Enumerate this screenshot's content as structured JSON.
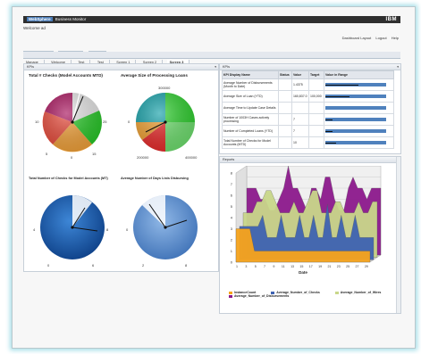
{
  "app": {
    "brand": "WebSphere",
    "product": "Business Monitor",
    "vendor": "IBM"
  },
  "welcome": "Welcome ad",
  "toplinks": {
    "dashboard_layout": "Dashboard Layout",
    "logout": "Logout",
    "help": "Help"
  },
  "top_tabs": [
    "Getting Started",
    "Dashboards",
    "Utilities"
  ],
  "nav_tabs": [
    "Manage",
    "Welcome",
    "Test",
    "Test",
    "Screen 1",
    "Screen 2",
    "Screen 3"
  ],
  "nav_selected": 6,
  "left_panel": {
    "title": "KPIs",
    "gauges": [
      {
        "title": "Total # Checks (Model Accounts MTD)",
        "labels": [
          "0",
          "5",
          "10",
          "15",
          "20",
          "25",
          "30"
        ]
      },
      {
        "title": "Average Size of Processing Loans",
        "labels": [
          "0",
          "100000",
          "200000",
          "300000",
          "400000"
        ]
      },
      {
        "title": "Total Number of Checks for Model Accounts (MT)",
        "labels": [
          "0",
          "2",
          "4",
          "6",
          "8"
        ]
      },
      {
        "title": "Average Number of Days Lists Disbursing",
        "labels": [
          "0",
          "2",
          "4",
          "6",
          "8"
        ]
      }
    ]
  },
  "kpi_panel": {
    "title": "KPIs",
    "columns": [
      "KPI Display Name",
      "Status",
      "Value",
      "Target",
      "Value in Range"
    ],
    "rows": [
      {
        "name": "Average Number of Disbursements (Month to Date)",
        "status": "",
        "value": "1.4375",
        "target": "",
        "fill": 0.55
      },
      {
        "name": "Average Size of Loan (YTD)",
        "status": "",
        "value": "160,837.0",
        "target": "100,000",
        "fill": 0.4
      },
      {
        "name": "Average Time to Update Case Details",
        "status": "",
        "value": "",
        "target": "",
        "fill": 0.0
      },
      {
        "name": "Number of 1003H Cases actively processing",
        "status": "",
        "value": "7",
        "target": "",
        "fill": 0.12
      },
      {
        "name": "Number of Completed Loans (YTD)",
        "status": "",
        "value": "7",
        "target": "",
        "fill": 0.12
      },
      {
        "name": "Total Number of Checks for Model Accounts (MTD)",
        "status": "",
        "value": "10",
        "target": "",
        "fill": 0.18
      }
    ]
  },
  "reports_panel": {
    "title": "Reports"
  },
  "chart_data": {
    "type": "area",
    "xlabel": "Date",
    "ylabel": "",
    "x": [
      1,
      2,
      3,
      4,
      5,
      6,
      7,
      8,
      9,
      10,
      11,
      12,
      13,
      14,
      15,
      16,
      17,
      18,
      19,
      20,
      21,
      22,
      23,
      24,
      25,
      26,
      27,
      28,
      29,
      30
    ],
    "ylim": [
      0,
      8
    ],
    "yticks": [
      0,
      1,
      2,
      3,
      4,
      5,
      6,
      7,
      8
    ],
    "xticks": [
      1,
      3,
      5,
      7,
      9,
      11,
      13,
      15,
      17,
      19,
      21,
      23,
      25,
      27,
      29
    ],
    "series": [
      {
        "name": "InstanceCount",
        "color": "#f7a41d",
        "values": [
          3,
          3,
          3,
          3,
          1,
          1,
          1,
          1,
          1,
          1,
          1,
          1,
          1,
          1,
          1,
          1,
          1,
          1,
          1,
          1,
          1,
          1,
          1,
          1,
          1,
          1,
          1,
          1,
          1,
          1
        ]
      },
      {
        "name": "Average_Number_of_Checks",
        "color": "#3f63b2",
        "values": [
          3,
          3,
          3,
          3,
          3,
          4,
          2,
          2,
          2,
          4,
          2,
          2,
          2,
          4,
          2,
          2,
          4,
          2,
          2,
          5,
          2,
          2,
          4,
          2,
          2,
          4,
          2,
          2,
          2,
          2
        ]
      },
      {
        "name": "Average_Number_of_Wires",
        "color": "#c9d78a",
        "values": [
          4,
          4,
          4,
          5,
          5,
          6,
          6,
          5,
          4,
          4,
          4,
          5,
          4,
          4,
          5,
          6,
          6,
          4,
          4,
          4,
          5,
          5,
          4,
          4,
          4,
          5,
          4,
          4,
          5,
          5
        ]
      },
      {
        "name": "Average_Number_of_Disbursements",
        "color": "#8c1a8c",
        "values": [
          6,
          6,
          6,
          5,
          5,
          4,
          4,
          5,
          6,
          8,
          6,
          6,
          5,
          4,
          6,
          6,
          5,
          7,
          7,
          5,
          4,
          4,
          6,
          7,
          6,
          6,
          5,
          6,
          6,
          6
        ]
      }
    ]
  },
  "colors": {
    "topbar": "#2f2f2f",
    "accent_glow": "#a7dfe8",
    "bullet_blue": "#4f81bd"
  }
}
